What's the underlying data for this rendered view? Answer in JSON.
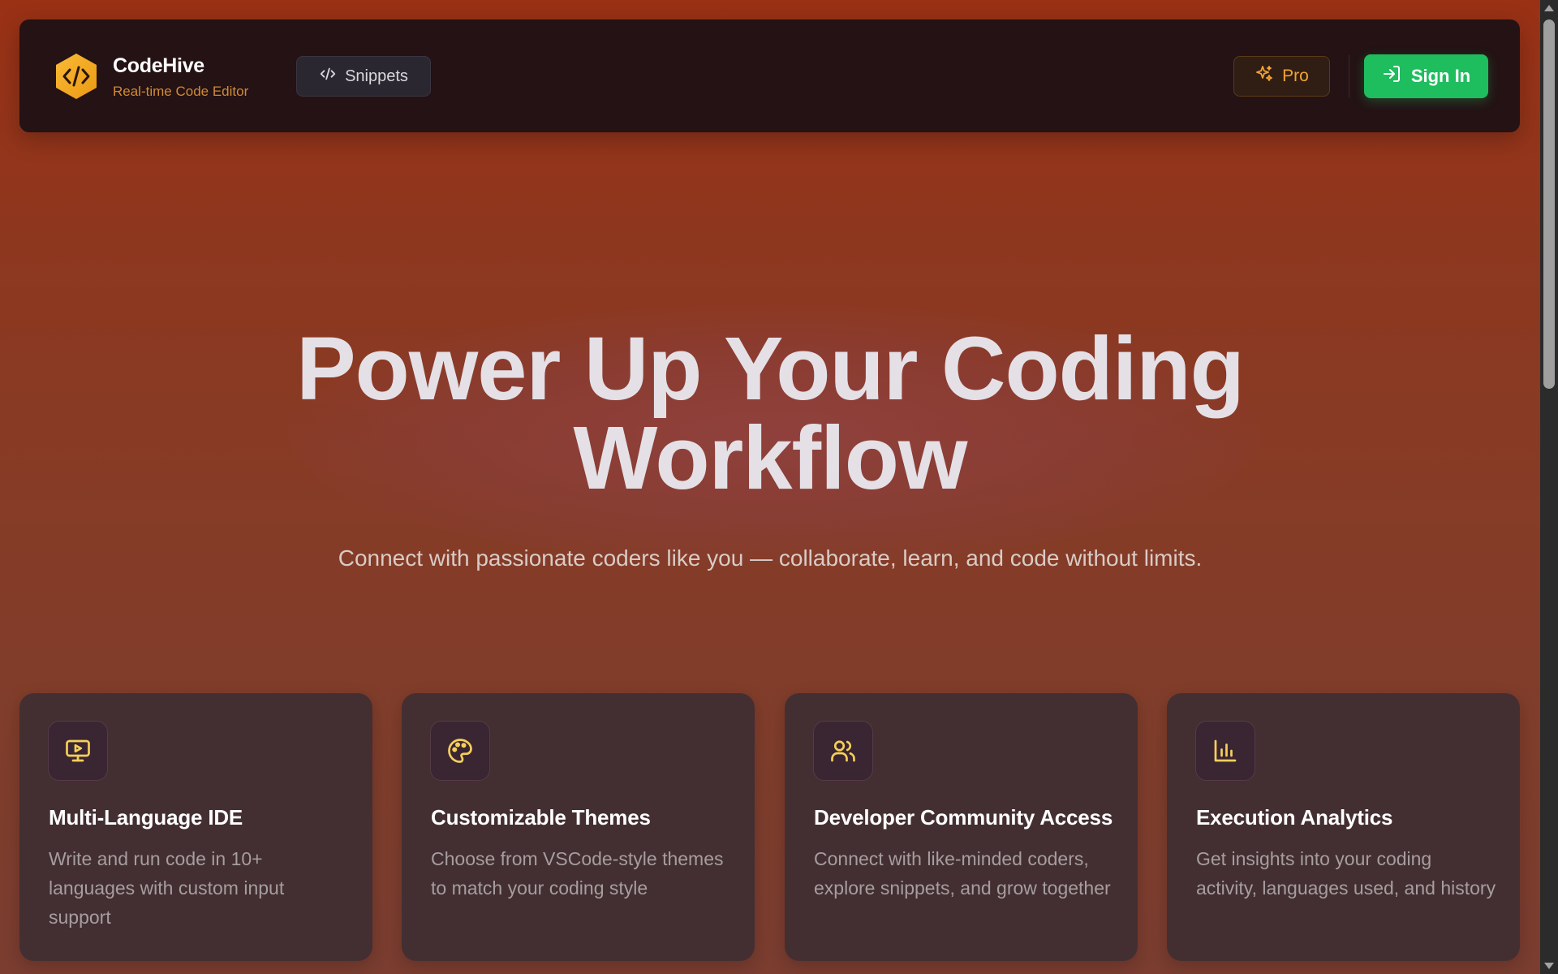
{
  "header": {
    "brand_name": "CodeHive",
    "brand_subtitle": "Real-time Code Editor",
    "snippets_label": "Snippets",
    "pro_label": "Pro",
    "signin_label": "Sign In"
  },
  "hero": {
    "title_line1": "Power Up Your Coding",
    "title_line2": "Workflow",
    "subtitle": "Connect with passionate coders like you — collaborate, learn, and code without limits."
  },
  "features": [
    {
      "icon": "monitor-play-icon",
      "title": "Multi-Language IDE",
      "description": "Write and run code in 10+ languages with custom input support"
    },
    {
      "icon": "palette-icon",
      "title": "Customizable Themes",
      "description": "Choose from VSCode-style themes to match your coding style"
    },
    {
      "icon": "users-icon",
      "title": "Developer Community Access",
      "description": "Connect with like-minded coders, explore snippets, and grow together"
    },
    {
      "icon": "bar-chart-icon",
      "title": "Execution Analytics",
      "description": "Get insights into your coding activity, languages used, and history"
    }
  ],
  "colors": {
    "accent_green": "#1ebd5e",
    "accent_gold": "#f2a531",
    "icon_yellow": "#f5cf5a",
    "header_bg": "#241214",
    "card_bg": "#432f32"
  }
}
